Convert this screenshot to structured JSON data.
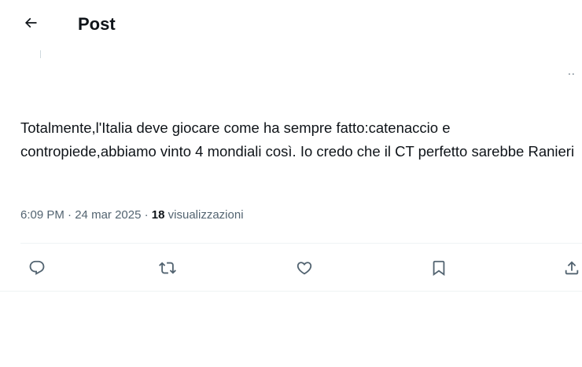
{
  "header": {
    "back_icon": "arrow-left-icon",
    "title": "Post"
  },
  "post": {
    "more_label": "..",
    "text": "Totalmente,l'Italia deve giocare come ha sempre fatto:catenaccio e contropiede,abbiamo vinto 4 mondiali così. Io credo che il CT perfetto sarebbe Ranieri",
    "time": "6:09 PM",
    "separator": " · ",
    "date": "24 mar 2025",
    "views_count": "18",
    "views_label": "visualizzazioni"
  },
  "actions": [
    {
      "name": "reply",
      "icon": "reply-icon"
    },
    {
      "name": "repost",
      "icon": "repost-icon"
    },
    {
      "name": "like",
      "icon": "heart-icon"
    },
    {
      "name": "bookmark",
      "icon": "bookmark-icon"
    },
    {
      "name": "share",
      "icon": "share-icon"
    }
  ],
  "colors": {
    "text": "#0f1419",
    "secondary": "#536471",
    "divider": "#eff3f4"
  }
}
